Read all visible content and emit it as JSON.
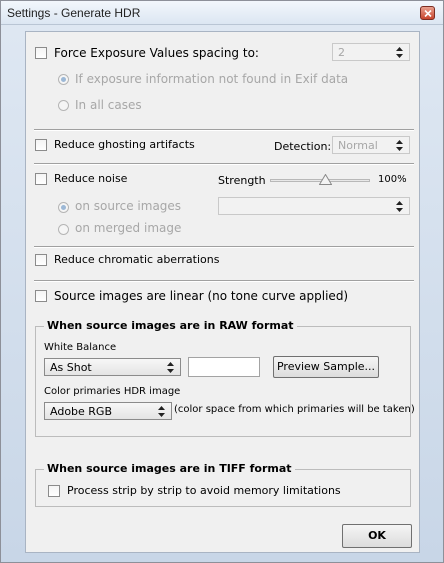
{
  "window": {
    "title": "Settings - Generate HDR"
  },
  "force_exposure": {
    "label": "Force Exposure Values spacing to:",
    "checked": false,
    "spacing_value": "2",
    "option_exif": "If exposure information not found in Exif data",
    "option_all": "In all cases"
  },
  "ghosting": {
    "label": "Reduce ghosting artifacts",
    "detection_label": "Detection:",
    "detection_value": "Normal"
  },
  "noise": {
    "label": "Reduce noise",
    "strength_label": "Strength",
    "strength_value": "100%",
    "strength_fraction": 0.55,
    "option_source": "on source images",
    "option_merged": "on merged image",
    "mode_value": ""
  },
  "chromatic": {
    "label": "Reduce chromatic aberrations"
  },
  "linear": {
    "label": "Source images are linear (no tone curve applied)"
  },
  "raw_group": {
    "legend": "When source images are in RAW format",
    "white_balance_label": "White Balance",
    "white_balance_value": "As Shot",
    "custom_value": "",
    "preview_button": "Preview Sample...",
    "color_primaries_label": "Color primaries HDR image",
    "color_primaries_value": "Adobe RGB",
    "color_primaries_note": "(color space from which primaries will be taken)"
  },
  "tiff_group": {
    "legend": "When source images are in TIFF format",
    "strip_label": "Process strip by strip to avoid memory limitations"
  },
  "footer": {
    "ok_button": "OK"
  },
  "colors": {
    "title_bar": "#dce6f2",
    "dialog_bg": "#f0f0f0",
    "close_button": "#c8452d"
  }
}
